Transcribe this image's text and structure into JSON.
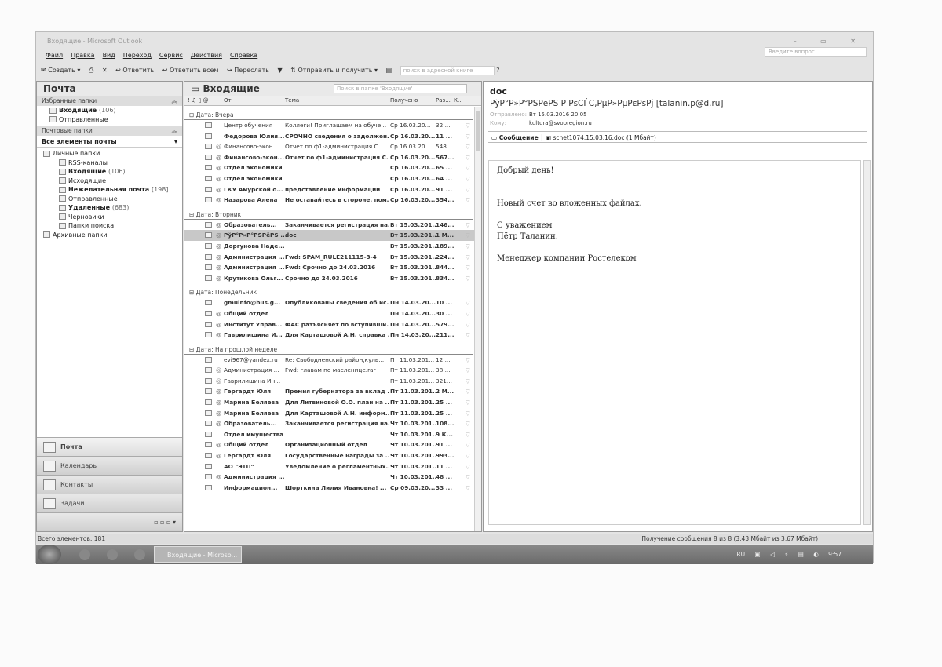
{
  "window": {
    "title": "Входящие - Microsoft Outlook",
    "controls": "– ▭ ✕"
  },
  "menu": [
    "Файл",
    "Правка",
    "Вид",
    "Переход",
    "Сервис",
    "Действия",
    "Справка"
  ],
  "ask_placeholder": "Введите вопрос",
  "toolbar": {
    "new": "Создать",
    "reply": "Ответить",
    "reply_all": "Ответить всем",
    "forward": "Переслать",
    "send_receive": "Отправить и получить",
    "addr_search": "поиск в адресной книге"
  },
  "nav": {
    "title": "Почта",
    "favorites_header": "Избранные папки",
    "favorites": [
      {
        "name": "Входящие",
        "count": "(106)",
        "bold": true
      },
      {
        "name": "Отправленные",
        "count": "",
        "bold": false
      }
    ],
    "mail_folders_header": "Почтовые папки",
    "all_items": "Все элементы почты",
    "tree": [
      {
        "name": "Личные папки",
        "count": "",
        "bold": false,
        "lvl": 0
      },
      {
        "name": "RSS-каналы",
        "count": "",
        "bold": false,
        "lvl": 1
      },
      {
        "name": "Входящие",
        "count": "(106)",
        "bold": true,
        "lvl": 1
      },
      {
        "name": "Исходящие",
        "count": "",
        "bold": false,
        "lvl": 1
      },
      {
        "name": "Нежелательная почта",
        "count": "[198]",
        "bold": true,
        "lvl": 1
      },
      {
        "name": "Отправленные",
        "count": "",
        "bold": false,
        "lvl": 1
      },
      {
        "name": "Удаленные",
        "count": "(683)",
        "bold": true,
        "lvl": 1
      },
      {
        "name": "Черновики",
        "count": "",
        "bold": false,
        "lvl": 1
      },
      {
        "name": "Папки поиска",
        "count": "",
        "bold": false,
        "lvl": 1
      },
      {
        "name": "Архивные папки",
        "count": "",
        "bold": false,
        "lvl": 0
      }
    ],
    "buttons": [
      "Почта",
      "Календарь",
      "Контакты",
      "Задачи"
    ]
  },
  "list": {
    "title": "Входящие",
    "search_placeholder": "Поиск в папке 'Входящие'",
    "columns": {
      "from": "От",
      "subject": "Тема",
      "received": "Получено",
      "size": "Раз...",
      "cat": "К..."
    },
    "groups": [
      {
        "label": "Дата: Вчера",
        "rows": [
          [
            "Центр обучения",
            "Коллеги! Приглашаем на обуче...",
            "Ср 16.03.20...",
            "32 ...",
            0,
            0
          ],
          [
            "Федорова Юлия...",
            "СРОЧНО сведения о задолжен...",
            "Ср 16.03.20...",
            "11 ...",
            1,
            0
          ],
          [
            "Финансово-экон...",
            "Отчет по ф1-администрация С...",
            "Ср 16.03.20...",
            "548...",
            0,
            1
          ],
          [
            "Финансово-экон...",
            "Отчет по ф1-администрация С...",
            "Ср 16.03.20...",
            "567...",
            1,
            1
          ],
          [
            "Отдел экономики",
            "",
            "Ср 16.03.20...",
            "65 ...",
            1,
            1
          ],
          [
            "Отдел экономики",
            "",
            "Ср 16.03.20...",
            "64 ...",
            1,
            1
          ],
          [
            "ГКУ Амурской о...",
            "представление информации",
            "Ср 16.03.20...",
            "91 ...",
            1,
            1
          ],
          [
            "Назарова Алена",
            "Не оставайтесь в стороне, пом...",
            "Ср 16.03.20...",
            "354...",
            1,
            1
          ]
        ]
      },
      {
        "label": "Дата: Вторник",
        "rows": [
          [
            "Образователь...",
            "Заканчивается регистрация на...",
            "Вт 15.03.201...",
            "146...",
            1,
            1
          ],
          [
            "РўР°Р»Р°РЅРёРЅ ...",
            "doc",
            "Вт 15.03.201...",
            "1 М...",
            1,
            1
          ],
          [
            "Доргунова Наде...",
            "",
            "Вт 15.03.201...",
            "189...",
            1,
            1
          ],
          [
            "Администрация ...",
            "Fwd: SPAM_RULE211115-3-4",
            "Вт 15.03.201...",
            "224...",
            1,
            1
          ],
          [
            "Администрация ...",
            "Fwd: Срочно до 24.03.2016",
            "Вт 15.03.201...",
            "844...",
            1,
            1
          ],
          [
            "Крутикова Ольг...",
            "Срочно до 24.03.2016",
            "Вт 15.03.201...",
            "834...",
            1,
            1
          ]
        ]
      },
      {
        "label": "Дата: Понедельник",
        "rows": [
          [
            "gmuinfo@bus.g...",
            "Опубликованы сведения об ис...",
            "Пн 14.03.20...",
            "10 ...",
            1,
            0
          ],
          [
            "Общий отдел",
            "",
            "Пн 14.03.20...",
            "30 ...",
            1,
            1
          ],
          [
            "Институт Управ...",
            "ФАС разъясняет по вступивши...",
            "Пн 14.03.20...",
            "579...",
            1,
            1
          ],
          [
            "Гаврилишина И...",
            "Для Карташовой А.Н. справка ...",
            "Пн 14.03.20...",
            "211...",
            1,
            1
          ]
        ]
      },
      {
        "label": "Дата: На прошлой неделе",
        "rows": [
          [
            "evi967@yandex.ru",
            "Re: Свободненский район,куль...",
            "Пт 11.03.201...",
            "12 ...",
            0,
            0
          ],
          [
            "Администрация ...",
            "Fwd: главам по масленице.rar",
            "Пт 11.03.201...",
            "38 ...",
            0,
            1
          ],
          [
            "Гаврилишина Ин...",
            "",
            "Пт 11.03.201...",
            "321...",
            0,
            1
          ],
          [
            "Гергардт Юля",
            "Премия губернатора за вклад ...",
            "Пт 11.03.201...",
            "2 М...",
            1,
            1
          ],
          [
            "Марина Беляева",
            "Для Литвиновой О.О. план на ...",
            "Пт 11.03.201...",
            "25 ...",
            1,
            1
          ],
          [
            "Марина Беляева",
            "Для Карташовой А.Н. информ...",
            "Пт 11.03.201...",
            "25 ...",
            1,
            1
          ],
          [
            "Образователь...",
            "Заканчивается регистрация на...",
            "Чт 10.03.201...",
            "108...",
            1,
            1
          ],
          [
            "Отдел имущества",
            "",
            "Чт 10.03.201...",
            "9 К...",
            1,
            0
          ],
          [
            "Общий отдел",
            "Организационный отдел",
            "Чт 10.03.201...",
            "91 ...",
            1,
            1
          ],
          [
            "Гергардт Юля",
            "Государственные награды за ...",
            "Чт 10.03.201...",
            "993...",
            1,
            1
          ],
          [
            "АО \"ЭТП\"",
            "Уведомление о регламентных...",
            "Чт 10.03.201...",
            "11 ...",
            1,
            0
          ],
          [
            "Администрация ...",
            "",
            "Чт 10.03.201...",
            "48 ...",
            1,
            1
          ],
          [
            "Информацион...",
            "Шорткина Лилия Ивановна! ...",
            "Ср 09.03.20...",
            "33 ...",
            1,
            0
          ]
        ]
      }
    ]
  },
  "reading": {
    "subject": "doc",
    "from": "РўР°Р»Р°РЅРёРЅ Р РѕСЃС‚РµР»РµРєРѕРј [talanin.p@d.ru]",
    "sent_label": "Отправлено:",
    "sent": "Вт 15.03.2016 20:05",
    "to_label": "Кому:",
    "to": "kultura@svobregion.ru",
    "message_tab": "Сообщение",
    "attachment": "schet1074.15.03.16.doc (1 Мбайт)",
    "body": {
      "greeting": "Добрый день!",
      "line1": "Новый счет во вложенных файлах.",
      "regards": "С уважением",
      "name": "Пётр Таланин.",
      "position": "Менеджер компании Ростелеком"
    }
  },
  "status": {
    "total": "Всего элементов: 181",
    "progress": "Получение сообщения 8 из 8 (3,43 Мбайт из 3,67 Мбайт)"
  },
  "taskbar": {
    "app": "Входящие - Microso...",
    "lang": "RU",
    "time": "9:57"
  }
}
